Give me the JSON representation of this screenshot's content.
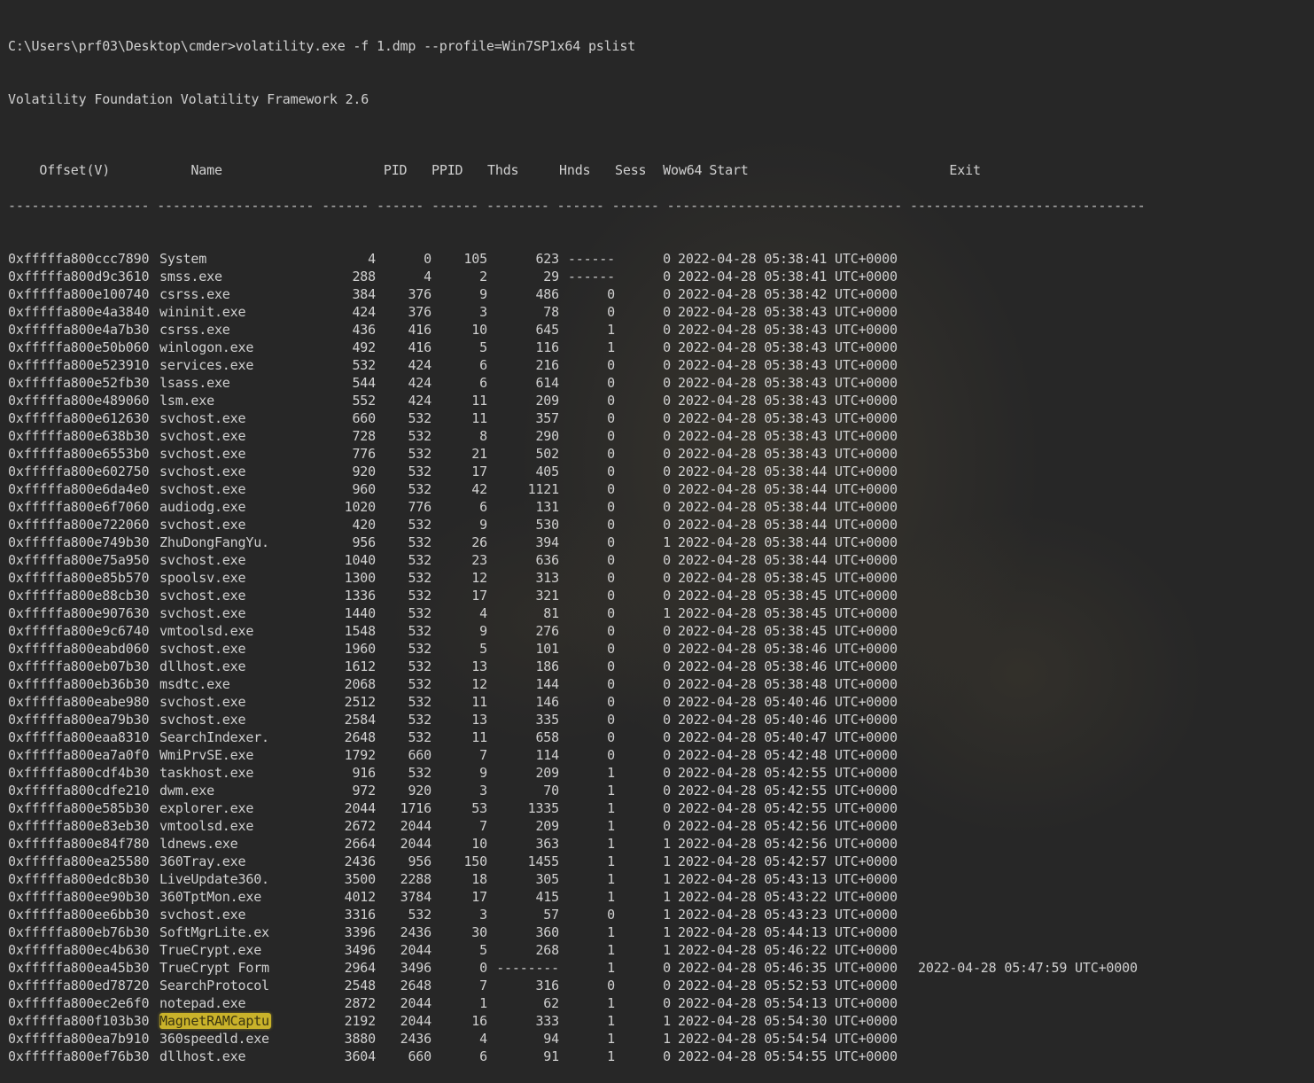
{
  "command_line": "C:\\Users\\prf03\\Desktop\\cmder>volatility.exe -f 1.dmp --profile=Win7SP1x64 pslist",
  "banner": "Volatility Foundation Volatility Framework 2.6",
  "headers": {
    "offset": "Offset(V)",
    "name": "Name",
    "pid": "PID",
    "ppid": "PPID",
    "thds": "Thds",
    "hnds": "Hnds",
    "sess": "Sess",
    "wow64": "Wow64",
    "start": "Start",
    "exit": "Exit"
  },
  "separators": {
    "offset": "------------------",
    "name": "--------------------",
    "pid": "------",
    "ppid": "------",
    "thds": "------",
    "hnds": "--------",
    "sess": "------",
    "wow64": "------",
    "start": "------------------------------",
    "exit": "------------------------------"
  },
  "highlight_color": "#c9b22a",
  "processes": [
    {
      "offset": "0xfffffa800ccc7890",
      "name": "System",
      "pid": "4",
      "ppid": "0",
      "thds": "105",
      "hnds": "623",
      "sess": "------",
      "wow64": "0",
      "start": "2022-04-28 05:38:41 UTC+0000",
      "exit": ""
    },
    {
      "offset": "0xfffffa800d9c3610",
      "name": "smss.exe",
      "pid": "288",
      "ppid": "4",
      "thds": "2",
      "hnds": "29",
      "sess": "------",
      "wow64": "0",
      "start": "2022-04-28 05:38:41 UTC+0000",
      "exit": ""
    },
    {
      "offset": "0xfffffa800e100740",
      "name": "csrss.exe",
      "pid": "384",
      "ppid": "376",
      "thds": "9",
      "hnds": "486",
      "sess": "0",
      "wow64": "0",
      "start": "2022-04-28 05:38:42 UTC+0000",
      "exit": ""
    },
    {
      "offset": "0xfffffa800e4a3840",
      "name": "wininit.exe",
      "pid": "424",
      "ppid": "376",
      "thds": "3",
      "hnds": "78",
      "sess": "0",
      "wow64": "0",
      "start": "2022-04-28 05:38:43 UTC+0000",
      "exit": ""
    },
    {
      "offset": "0xfffffa800e4a7b30",
      "name": "csrss.exe",
      "pid": "436",
      "ppid": "416",
      "thds": "10",
      "hnds": "645",
      "sess": "1",
      "wow64": "0",
      "start": "2022-04-28 05:38:43 UTC+0000",
      "exit": ""
    },
    {
      "offset": "0xfffffa800e50b060",
      "name": "winlogon.exe",
      "pid": "492",
      "ppid": "416",
      "thds": "5",
      "hnds": "116",
      "sess": "1",
      "wow64": "0",
      "start": "2022-04-28 05:38:43 UTC+0000",
      "exit": ""
    },
    {
      "offset": "0xfffffa800e523910",
      "name": "services.exe",
      "pid": "532",
      "ppid": "424",
      "thds": "6",
      "hnds": "216",
      "sess": "0",
      "wow64": "0",
      "start": "2022-04-28 05:38:43 UTC+0000",
      "exit": ""
    },
    {
      "offset": "0xfffffa800e52fb30",
      "name": "lsass.exe",
      "pid": "544",
      "ppid": "424",
      "thds": "6",
      "hnds": "614",
      "sess": "0",
      "wow64": "0",
      "start": "2022-04-28 05:38:43 UTC+0000",
      "exit": ""
    },
    {
      "offset": "0xfffffa800e489060",
      "name": "lsm.exe",
      "pid": "552",
      "ppid": "424",
      "thds": "11",
      "hnds": "209",
      "sess": "0",
      "wow64": "0",
      "start": "2022-04-28 05:38:43 UTC+0000",
      "exit": ""
    },
    {
      "offset": "0xfffffa800e612630",
      "name": "svchost.exe",
      "pid": "660",
      "ppid": "532",
      "thds": "11",
      "hnds": "357",
      "sess": "0",
      "wow64": "0",
      "start": "2022-04-28 05:38:43 UTC+0000",
      "exit": ""
    },
    {
      "offset": "0xfffffa800e638b30",
      "name": "svchost.exe",
      "pid": "728",
      "ppid": "532",
      "thds": "8",
      "hnds": "290",
      "sess": "0",
      "wow64": "0",
      "start": "2022-04-28 05:38:43 UTC+0000",
      "exit": ""
    },
    {
      "offset": "0xfffffa800e6553b0",
      "name": "svchost.exe",
      "pid": "776",
      "ppid": "532",
      "thds": "21",
      "hnds": "502",
      "sess": "0",
      "wow64": "0",
      "start": "2022-04-28 05:38:43 UTC+0000",
      "exit": ""
    },
    {
      "offset": "0xfffffa800e602750",
      "name": "svchost.exe",
      "pid": "920",
      "ppid": "532",
      "thds": "17",
      "hnds": "405",
      "sess": "0",
      "wow64": "0",
      "start": "2022-04-28 05:38:44 UTC+0000",
      "exit": ""
    },
    {
      "offset": "0xfffffa800e6da4e0",
      "name": "svchost.exe",
      "pid": "960",
      "ppid": "532",
      "thds": "42",
      "hnds": "1121",
      "sess": "0",
      "wow64": "0",
      "start": "2022-04-28 05:38:44 UTC+0000",
      "exit": ""
    },
    {
      "offset": "0xfffffa800e6f7060",
      "name": "audiodg.exe",
      "pid": "1020",
      "ppid": "776",
      "thds": "6",
      "hnds": "131",
      "sess": "0",
      "wow64": "0",
      "start": "2022-04-28 05:38:44 UTC+0000",
      "exit": ""
    },
    {
      "offset": "0xfffffa800e722060",
      "name": "svchost.exe",
      "pid": "420",
      "ppid": "532",
      "thds": "9",
      "hnds": "530",
      "sess": "0",
      "wow64": "0",
      "start": "2022-04-28 05:38:44 UTC+0000",
      "exit": ""
    },
    {
      "offset": "0xfffffa800e749b30",
      "name": "ZhuDongFangYu.",
      "pid": "956",
      "ppid": "532",
      "thds": "26",
      "hnds": "394",
      "sess": "0",
      "wow64": "1",
      "start": "2022-04-28 05:38:44 UTC+0000",
      "exit": ""
    },
    {
      "offset": "0xfffffa800e75a950",
      "name": "svchost.exe",
      "pid": "1040",
      "ppid": "532",
      "thds": "23",
      "hnds": "636",
      "sess": "0",
      "wow64": "0",
      "start": "2022-04-28 05:38:44 UTC+0000",
      "exit": ""
    },
    {
      "offset": "0xfffffa800e85b570",
      "name": "spoolsv.exe",
      "pid": "1300",
      "ppid": "532",
      "thds": "12",
      "hnds": "313",
      "sess": "0",
      "wow64": "0",
      "start": "2022-04-28 05:38:45 UTC+0000",
      "exit": ""
    },
    {
      "offset": "0xfffffa800e88cb30",
      "name": "svchost.exe",
      "pid": "1336",
      "ppid": "532",
      "thds": "17",
      "hnds": "321",
      "sess": "0",
      "wow64": "0",
      "start": "2022-04-28 05:38:45 UTC+0000",
      "exit": ""
    },
    {
      "offset": "0xfffffa800e907630",
      "name": "svchost.exe",
      "pid": "1440",
      "ppid": "532",
      "thds": "4",
      "hnds": "81",
      "sess": "0",
      "wow64": "1",
      "start": "2022-04-28 05:38:45 UTC+0000",
      "exit": ""
    },
    {
      "offset": "0xfffffa800e9c6740",
      "name": "vmtoolsd.exe",
      "pid": "1548",
      "ppid": "532",
      "thds": "9",
      "hnds": "276",
      "sess": "0",
      "wow64": "0",
      "start": "2022-04-28 05:38:45 UTC+0000",
      "exit": ""
    },
    {
      "offset": "0xfffffa800eabd060",
      "name": "svchost.exe",
      "pid": "1960",
      "ppid": "532",
      "thds": "5",
      "hnds": "101",
      "sess": "0",
      "wow64": "0",
      "start": "2022-04-28 05:38:46 UTC+0000",
      "exit": ""
    },
    {
      "offset": "0xfffffa800eb07b30",
      "name": "dllhost.exe",
      "pid": "1612",
      "ppid": "532",
      "thds": "13",
      "hnds": "186",
      "sess": "0",
      "wow64": "0",
      "start": "2022-04-28 05:38:46 UTC+0000",
      "exit": ""
    },
    {
      "offset": "0xfffffa800eb36b30",
      "name": "msdtc.exe",
      "pid": "2068",
      "ppid": "532",
      "thds": "12",
      "hnds": "144",
      "sess": "0",
      "wow64": "0",
      "start": "2022-04-28 05:38:48 UTC+0000",
      "exit": ""
    },
    {
      "offset": "0xfffffa800eabe980",
      "name": "svchost.exe",
      "pid": "2512",
      "ppid": "532",
      "thds": "11",
      "hnds": "146",
      "sess": "0",
      "wow64": "0",
      "start": "2022-04-28 05:40:46 UTC+0000",
      "exit": ""
    },
    {
      "offset": "0xfffffa800ea79b30",
      "name": "svchost.exe",
      "pid": "2584",
      "ppid": "532",
      "thds": "13",
      "hnds": "335",
      "sess": "0",
      "wow64": "0",
      "start": "2022-04-28 05:40:46 UTC+0000",
      "exit": ""
    },
    {
      "offset": "0xfffffa800eaa8310",
      "name": "SearchIndexer.",
      "pid": "2648",
      "ppid": "532",
      "thds": "11",
      "hnds": "658",
      "sess": "0",
      "wow64": "0",
      "start": "2022-04-28 05:40:47 UTC+0000",
      "exit": ""
    },
    {
      "offset": "0xfffffa800ea7a0f0",
      "name": "WmiPrvSE.exe",
      "pid": "1792",
      "ppid": "660",
      "thds": "7",
      "hnds": "114",
      "sess": "0",
      "wow64": "0",
      "start": "2022-04-28 05:42:48 UTC+0000",
      "exit": ""
    },
    {
      "offset": "0xfffffa800cdf4b30",
      "name": "taskhost.exe",
      "pid": "916",
      "ppid": "532",
      "thds": "9",
      "hnds": "209",
      "sess": "1",
      "wow64": "0",
      "start": "2022-04-28 05:42:55 UTC+0000",
      "exit": ""
    },
    {
      "offset": "0xfffffa800cdfe210",
      "name": "dwm.exe",
      "pid": "972",
      "ppid": "920",
      "thds": "3",
      "hnds": "70",
      "sess": "1",
      "wow64": "0",
      "start": "2022-04-28 05:42:55 UTC+0000",
      "exit": ""
    },
    {
      "offset": "0xfffffa800e585b30",
      "name": "explorer.exe",
      "pid": "2044",
      "ppid": "1716",
      "thds": "53",
      "hnds": "1335",
      "sess": "1",
      "wow64": "0",
      "start": "2022-04-28 05:42:55 UTC+0000",
      "exit": ""
    },
    {
      "offset": "0xfffffa800e83eb30",
      "name": "vmtoolsd.exe",
      "pid": "2672",
      "ppid": "2044",
      "thds": "7",
      "hnds": "209",
      "sess": "1",
      "wow64": "0",
      "start": "2022-04-28 05:42:56 UTC+0000",
      "exit": ""
    },
    {
      "offset": "0xfffffa800e84f780",
      "name": "ldnews.exe",
      "pid": "2664",
      "ppid": "2044",
      "thds": "10",
      "hnds": "363",
      "sess": "1",
      "wow64": "1",
      "start": "2022-04-28 05:42:56 UTC+0000",
      "exit": ""
    },
    {
      "offset": "0xfffffa800ea25580",
      "name": "360Tray.exe",
      "pid": "2436",
      "ppid": "956",
      "thds": "150",
      "hnds": "1455",
      "sess": "1",
      "wow64": "1",
      "start": "2022-04-28 05:42:57 UTC+0000",
      "exit": ""
    },
    {
      "offset": "0xfffffa800edc8b30",
      "name": "LiveUpdate360.",
      "pid": "3500",
      "ppid": "2288",
      "thds": "18",
      "hnds": "305",
      "sess": "1",
      "wow64": "1",
      "start": "2022-04-28 05:43:13 UTC+0000",
      "exit": ""
    },
    {
      "offset": "0xfffffa800ee90b30",
      "name": "360TptMon.exe",
      "pid": "4012",
      "ppid": "3784",
      "thds": "17",
      "hnds": "415",
      "sess": "1",
      "wow64": "1",
      "start": "2022-04-28 05:43:22 UTC+0000",
      "exit": ""
    },
    {
      "offset": "0xfffffa800ee6bb30",
      "name": "svchost.exe",
      "pid": "3316",
      "ppid": "532",
      "thds": "3",
      "hnds": "57",
      "sess": "0",
      "wow64": "1",
      "start": "2022-04-28 05:43:23 UTC+0000",
      "exit": ""
    },
    {
      "offset": "0xfffffa800eb76b30",
      "name": "SoftMgrLite.ex",
      "pid": "3396",
      "ppid": "2436",
      "thds": "30",
      "hnds": "360",
      "sess": "1",
      "wow64": "1",
      "start": "2022-04-28 05:44:13 UTC+0000",
      "exit": ""
    },
    {
      "offset": "0xfffffa800ec4b630",
      "name": "TrueCrypt.exe",
      "pid": "3496",
      "ppid": "2044",
      "thds": "5",
      "hnds": "268",
      "sess": "1",
      "wow64": "1",
      "start": "2022-04-28 05:46:22 UTC+0000",
      "exit": ""
    },
    {
      "offset": "0xfffffa800ea45b30",
      "name": "TrueCrypt Form",
      "pid": "2964",
      "ppid": "3496",
      "thds": "0",
      "hnds": "--------",
      "sess": "1",
      "wow64": "0",
      "start": "2022-04-28 05:46:35 UTC+0000",
      "exit": "2022-04-28 05:47:59 UTC+0000"
    },
    {
      "offset": "0xfffffa800ed78720",
      "name": "SearchProtocol",
      "pid": "2548",
      "ppid": "2648",
      "thds": "7",
      "hnds": "316",
      "sess": "0",
      "wow64": "0",
      "start": "2022-04-28 05:52:53 UTC+0000",
      "exit": ""
    },
    {
      "offset": "0xfffffa800ec2e6f0",
      "name": "notepad.exe",
      "pid": "2872",
      "ppid": "2044",
      "thds": "1",
      "hnds": "62",
      "sess": "1",
      "wow64": "0",
      "start": "2022-04-28 05:54:13 UTC+0000",
      "exit": ""
    },
    {
      "offset": "0xfffffa800f103b30",
      "name": "MagnetRAMCaptu",
      "pid": "2192",
      "ppid": "2044",
      "thds": "16",
      "hnds": "333",
      "sess": "1",
      "wow64": "1",
      "start": "2022-04-28 05:54:30 UTC+0000",
      "exit": "",
      "highlighted": true
    },
    {
      "offset": "0xfffffa800ea7b910",
      "name": "360speedld.exe",
      "pid": "3880",
      "ppid": "2436",
      "thds": "4",
      "hnds": "94",
      "sess": "1",
      "wow64": "1",
      "start": "2022-04-28 05:54:54 UTC+0000",
      "exit": ""
    },
    {
      "offset": "0xfffffa800ef76b30",
      "name": "dllhost.exe",
      "pid": "3604",
      "ppid": "660",
      "thds": "6",
      "hnds": "91",
      "sess": "1",
      "wow64": "0",
      "start": "2022-04-28 05:54:55 UTC+0000",
      "exit": ""
    }
  ]
}
